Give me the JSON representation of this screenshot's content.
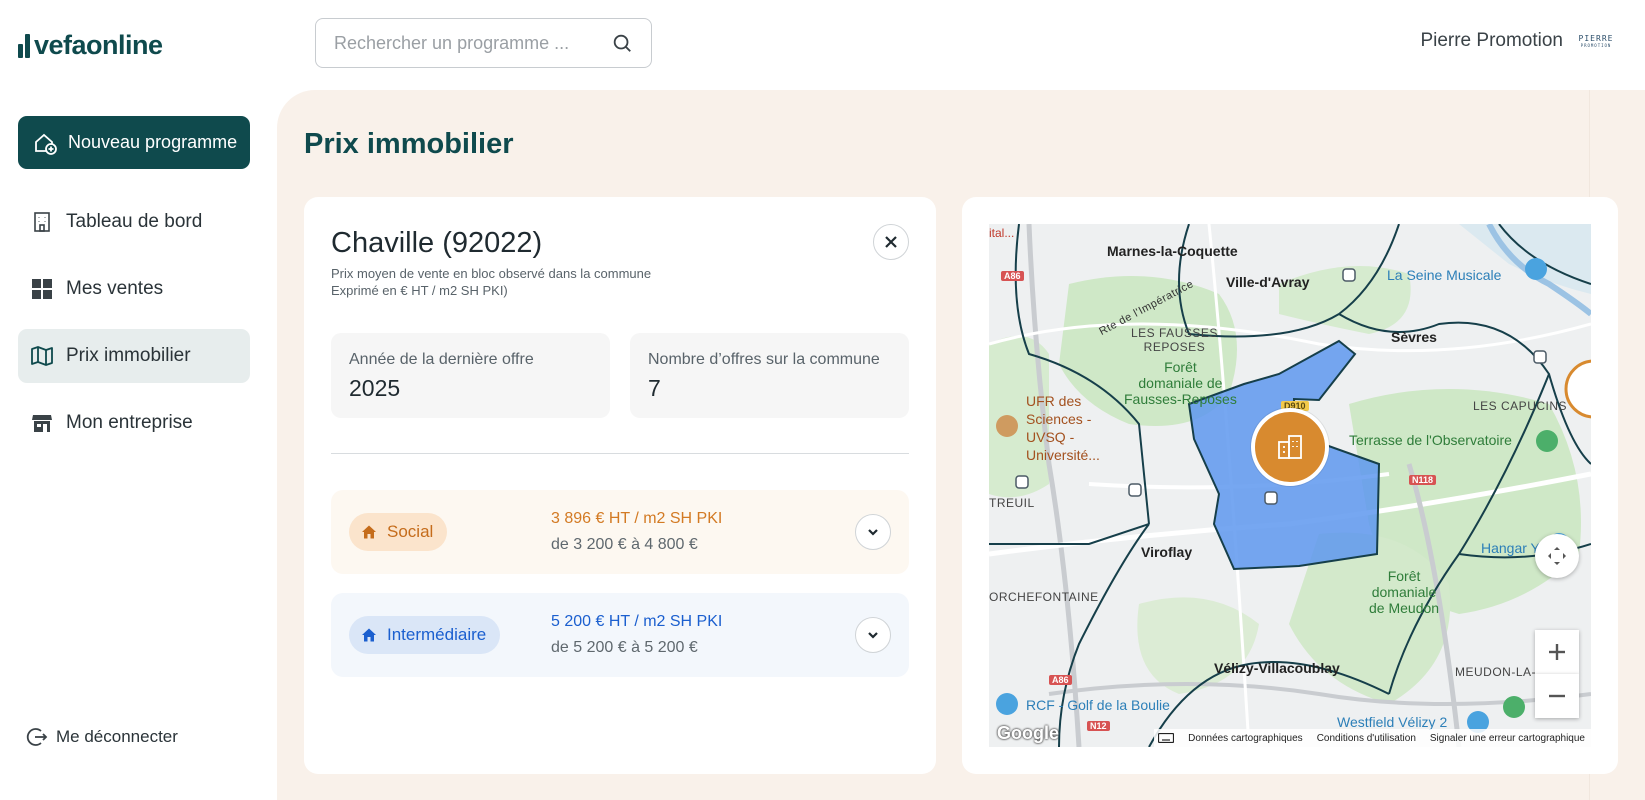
{
  "header": {
    "logo_text": "vefaonline",
    "search_placeholder": "Rechercher un programme ...",
    "user_name": "Pierre Promotion",
    "company_logo_line1": "PIERRE",
    "company_logo_line2": "PROMOTION"
  },
  "sidebar": {
    "new_button": "Nouveau programme",
    "items": [
      {
        "label": "Tableau de bord",
        "icon": "building-icon"
      },
      {
        "label": "Mes ventes",
        "icon": "grid-icon"
      },
      {
        "label": "Prix immobilier",
        "icon": "map-icon"
      },
      {
        "label": "Mon entreprise",
        "icon": "store-icon"
      }
    ],
    "active_item": "Prix immobilier",
    "logout": "Me déconnecter"
  },
  "main": {
    "title": "Prix immobilier",
    "card": {
      "city": "Chaville (92022)",
      "subtitle_line1": "Prix moyen de vente en bloc observé dans la commune",
      "subtitle_line2": "Exprimé en € HT / m2 SH PKI)",
      "stats": [
        {
          "label": "Année de la dernière offre",
          "value": "2025"
        },
        {
          "label": "Nombre d’offres sur la commune",
          "value": "7"
        }
      ],
      "prices": [
        {
          "badge": "Social",
          "price": "3 896 € HT / m2 SH PKI",
          "range": "de 3 200 € à 4 800 €",
          "color": "#d37a23"
        },
        {
          "badge": "Intermédiaire",
          "price": "5 200 € HT / m2 SH PKI",
          "range": "de 5 200 € à 5 200 €",
          "color": "#1b5fcf"
        }
      ]
    },
    "map": {
      "places": {
        "marnes": "Marnes-la-Coquette",
        "ville_davray": "Ville-d'Avray",
        "sevres": "Sèvres",
        "viroflay": "Viroflay",
        "velizy": "Vélizy-Villacoublay",
        "fausses_reposes": "LES FAUSSES\nREPOSES",
        "foret_fausses": "Forêt\ndomaniale de\nFausses-Reposes",
        "foret_meudon": "Forêt\ndomaniale\nde Meudon",
        "capucins": "LES CAPUCINS",
        "meudon_la": "MEUDON-LA-",
        "orchefontaine": "ORCHEFONTAINE",
        "creuil": "TREUIL",
        "seine_musicale": "La Seine Musicale",
        "terrasse": "Terrasse de l'Observatoire",
        "hangar": "Hangar Y",
        "ufr": "UFR des\nSciences -\nUVSQ -\nUniversité...",
        "rcf": "RCF - Golf de la Boulie",
        "westfield": "Westfield Vélizy 2",
        "rte_imperatrice": "Rte de l'Impératrice",
        "ital": "ital..."
      },
      "roads": [
        "A86",
        "N118",
        "A86",
        "N12",
        "D910"
      ],
      "attribution": {
        "data": "Données cartographiques",
        "terms": "Conditions d'utilisation",
        "report": "Signaler une erreur cartographique",
        "google": "Google"
      }
    }
  }
}
